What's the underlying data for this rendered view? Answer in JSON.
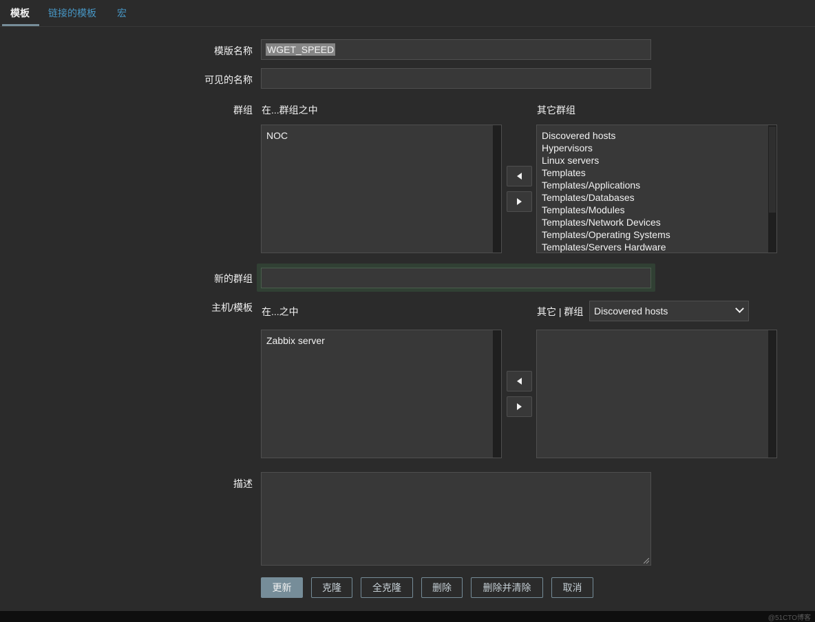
{
  "tabs": [
    {
      "label": "模板",
      "active": true
    },
    {
      "label": "链接的模板",
      "active": false
    },
    {
      "label": "宏",
      "active": false
    }
  ],
  "form": {
    "template_name_label": "模版名称",
    "template_name_value": "WGET_SPEED",
    "visible_name_label": "可见的名称",
    "visible_name_value": "",
    "groups_label": "群组",
    "groups_in_label": "在...群组之中",
    "groups_other_label": "其它群组",
    "groups_in": [
      "NOC"
    ],
    "groups_other": [
      "Discovered hosts",
      "Hypervisors",
      "Linux servers",
      "Templates",
      "Templates/Applications",
      "Templates/Databases",
      "Templates/Modules",
      "Templates/Network Devices",
      "Templates/Operating Systems",
      "Templates/Servers Hardware"
    ],
    "new_group_label": "新的群组",
    "new_group_value": "",
    "hosts_label": "主机/模板",
    "hosts_in_label": "在...之中",
    "hosts_other_label": "其它 | 群组",
    "hosts_group_select": "Discovered hosts",
    "hosts_in": [
      "Zabbix server"
    ],
    "hosts_other": [],
    "description_label": "描述",
    "description_value": ""
  },
  "buttons": {
    "update": "更新",
    "clone": "克隆",
    "full_clone": "全克隆",
    "delete": "删除",
    "delete_and_clear": "删除并清除",
    "cancel": "取消"
  },
  "watermark": "@51CTO博客"
}
